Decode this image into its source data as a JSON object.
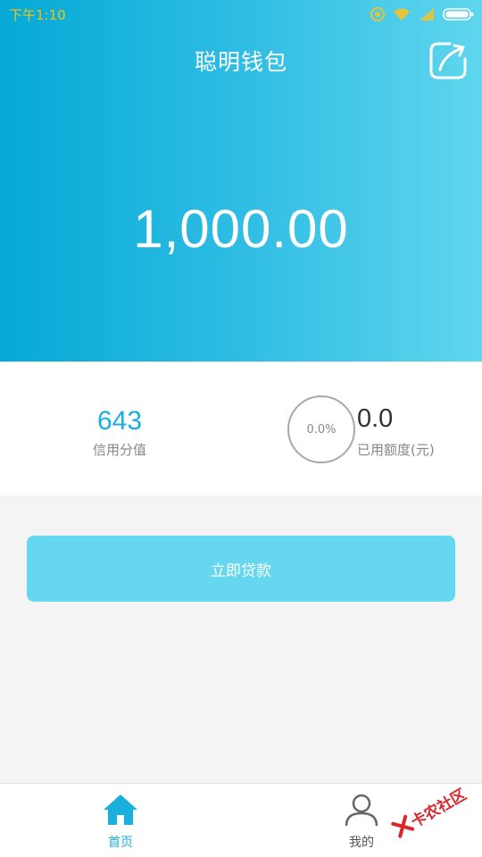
{
  "status_bar": {
    "time": "下午1:10",
    "icons": [
      "notification-icon",
      "wifi-icon",
      "signal-icon",
      "battery-icon"
    ]
  },
  "header": {
    "title": "聪明钱包",
    "share_icon": "share-icon"
  },
  "balance": {
    "amount": "1,000.00"
  },
  "stats": {
    "credit_score": "643",
    "credit_score_label": "信用分值",
    "usage_percent": "0.0%",
    "used_amount": "0.0",
    "used_amount_label": "已用额度(元)"
  },
  "actions": {
    "loan_button": "立即贷款"
  },
  "bottom_nav": {
    "items": [
      {
        "label": "首页",
        "icon": "home-icon",
        "active": true
      },
      {
        "label": "我的",
        "icon": "user-icon",
        "active": false
      }
    ]
  },
  "watermark": {
    "text": "卡农社区"
  },
  "colors": {
    "accent": "#1ab0dd",
    "button": "#65d7ef",
    "gradient_start": "#05a9d6",
    "gradient_end": "#5fd6ee"
  }
}
